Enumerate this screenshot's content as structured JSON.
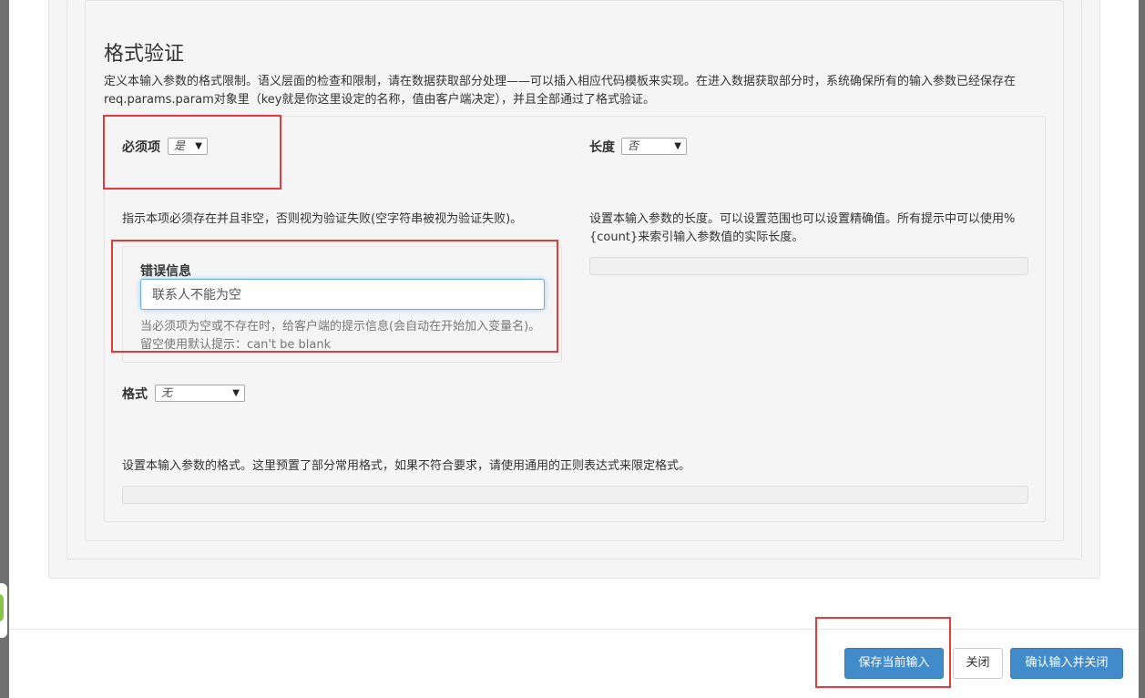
{
  "section": {
    "title": "格式验证",
    "description": "定义本输入参数的格式限制。语义层面的检查和限制，请在数据获取部分处理——可以插入相应代码模板来实现。在进入数据获取部分时，系统确保所有的输入参数已经保存在req.params.param对象里（key就是你这里设定的名称，值由客户端决定），并且全部通过了格式验证。"
  },
  "required": {
    "label": "必须项",
    "value": "是",
    "help": "指示本项必须存在并且非空，否则视为验证失败(空字符串被视为验证失败)。"
  },
  "length": {
    "label": "长度",
    "value": "否",
    "help": "设置本输入参数的长度。可以设置范围也可以设置精确值。所有提示中可以使用%{count}来索引输入参数值的实际长度。"
  },
  "error": {
    "label": "错误信息",
    "value": "联系人不能为空",
    "help": "当必须项为空或不存在时，给客户端的提示信息(会自动在开始加入变量名)。留空使用默认提示：can't be blank"
  },
  "format": {
    "label": "格式",
    "value": "无",
    "help": "设置本输入参数的格式。这里预置了部分常用格式，如果不符合要求，请使用通用的正则表达式来限定格式。"
  },
  "footer": {
    "save": "保存当前输入",
    "close": "关闭",
    "confirm": "确认输入并关闭"
  },
  "colors": {
    "primary": "#428bca",
    "highlight": "#e53b3b",
    "focus": "#66afe9"
  }
}
